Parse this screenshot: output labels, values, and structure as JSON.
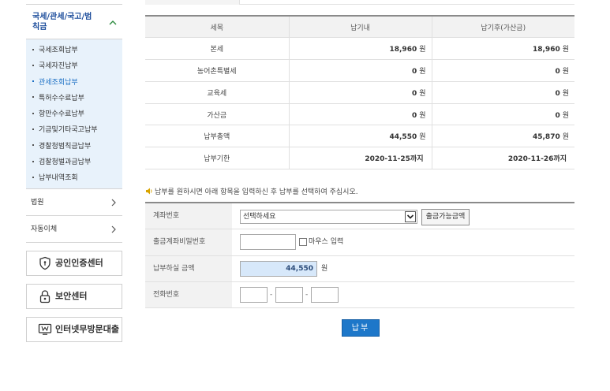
{
  "sidebar": {
    "section_title_line1": "국세/관세/국고/범",
    "section_title_line2": "칙금",
    "items": [
      {
        "label": "국세조회납부",
        "active": false
      },
      {
        "label": "국세자진납부",
        "active": false
      },
      {
        "label": "관세조회납부",
        "active": true
      },
      {
        "label": "특허수수료납부",
        "active": false
      },
      {
        "label": "항만수수료납부",
        "active": false
      },
      {
        "label": "기금및기타국고납부",
        "active": false
      },
      {
        "label": "경찰청범칙금납부",
        "active": false
      },
      {
        "label": "검찰청벌과금납부",
        "active": false
      },
      {
        "label": "납부내역조회",
        "active": false
      }
    ],
    "collapsed_sections": [
      {
        "label": "법원"
      },
      {
        "label": "자동이체"
      }
    ],
    "buttons": [
      {
        "label": "공인인증센터",
        "icon": "shield-icon"
      },
      {
        "label": "보안센터",
        "icon": "lock-icon"
      },
      {
        "label": "인터넷무방문대출",
        "icon": "monitor-w-icon"
      }
    ]
  },
  "tax_table": {
    "headers": [
      "세목",
      "납기내",
      "납기후(가산금)"
    ],
    "rows": [
      {
        "name": "본세",
        "before": "18,960",
        "before_unit": "원",
        "after": "18,960",
        "after_unit": "원"
      },
      {
        "name": "농어촌특별세",
        "before": "0",
        "before_unit": "원",
        "after": "0",
        "after_unit": "원"
      },
      {
        "name": "교육세",
        "before": "0",
        "before_unit": "원",
        "after": "0",
        "after_unit": "원"
      },
      {
        "name": "가산금",
        "before": "0",
        "before_unit": "원",
        "after": "0",
        "after_unit": "원"
      },
      {
        "name": "납부총액",
        "before": "44,550",
        "before_unit": "원",
        "after": "45,870",
        "after_unit": "원"
      },
      {
        "name": "납부기한",
        "before": "2020-11-25까지",
        "before_unit": "",
        "after": "2020-11-26까지",
        "after_unit": ""
      }
    ]
  },
  "notice": "납부를 원하시면 아래 항목을 입력하신 후 납부를 선택하여 주십시오.",
  "form": {
    "account_label": "계좌번호",
    "account_select_value": "선택하세요",
    "withdraw_available_button": "출금가능금액",
    "password_label": "출금계좌비밀번호",
    "password_value": "",
    "mouse_input_label": "마우스 입력",
    "amount_label": "납부하실 금액",
    "amount_value": "44,550",
    "amount_unit": "원",
    "phone_label": "전화번호",
    "phone_part1": "",
    "phone_part2": "",
    "phone_part3": "",
    "dash": "-"
  },
  "pay_button": "납부",
  "colors": {
    "accent": "#1d77c9",
    "sidebar_title": "#1a4b9a",
    "submenu_bg": "#e8f2fb",
    "amount_bg": "#d7e8fa"
  }
}
